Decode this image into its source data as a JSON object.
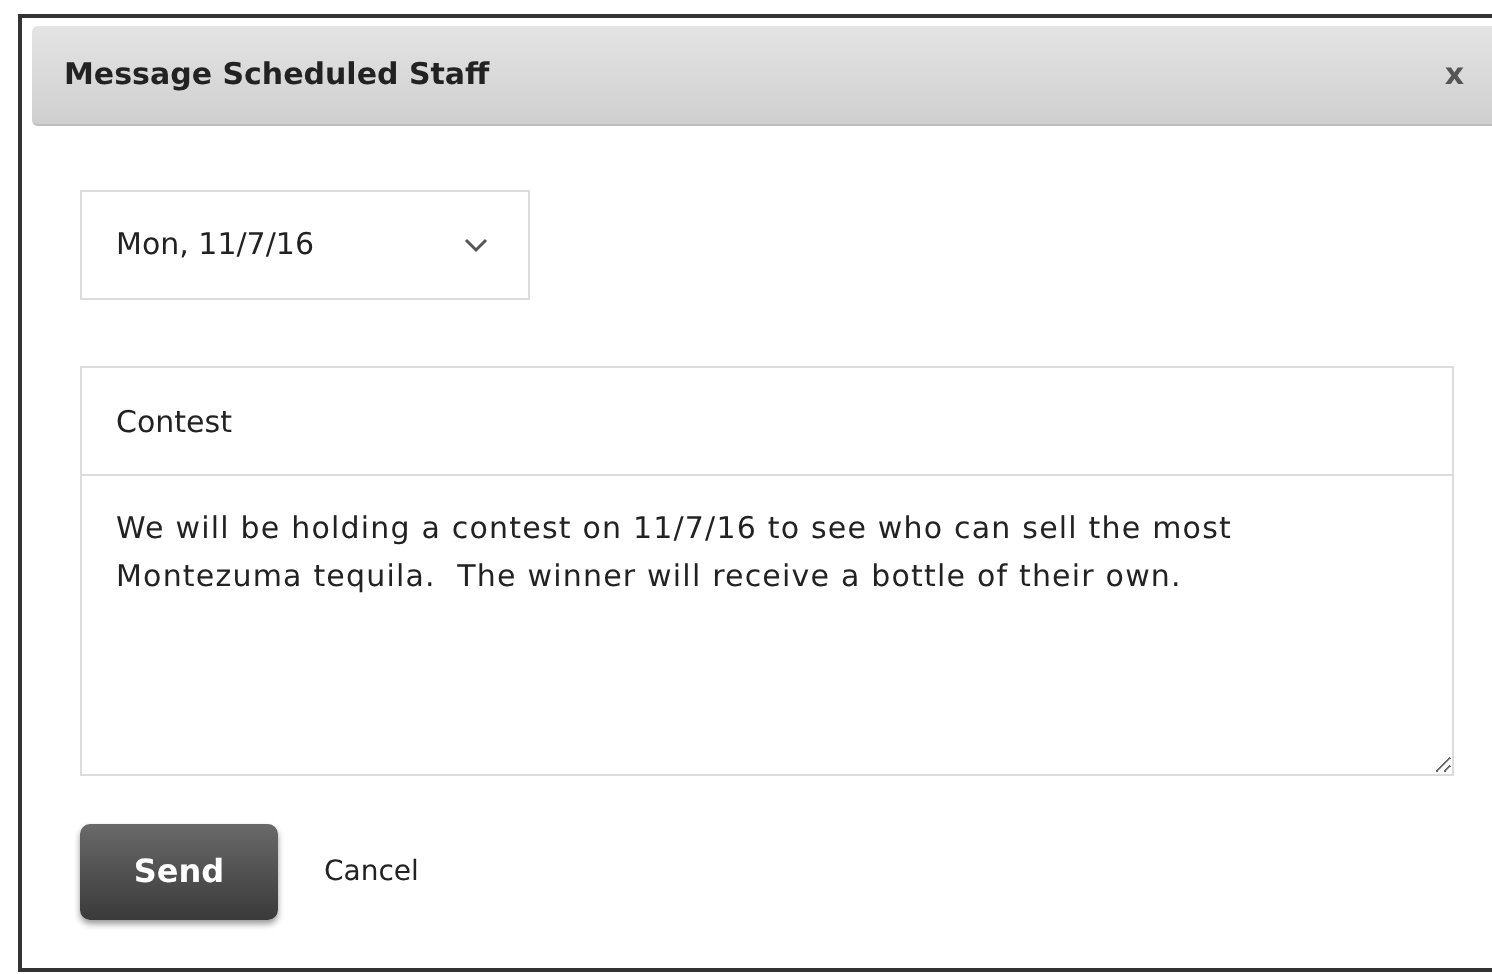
{
  "dialog": {
    "title": "Message Scheduled Staff",
    "close": "x"
  },
  "date_select": {
    "value": "Mon, 11/7/16"
  },
  "subject": {
    "value": "Contest"
  },
  "message": {
    "value": "We will be holding a contest on 11/7/16 to see who can sell the most Montezuma tequila.  The winner will receive a bottle of their own."
  },
  "buttons": [
    {
      "kind": "primary",
      "label": "Send"
    },
    {
      "kind": "link",
      "label": "Cancel"
    }
  ]
}
